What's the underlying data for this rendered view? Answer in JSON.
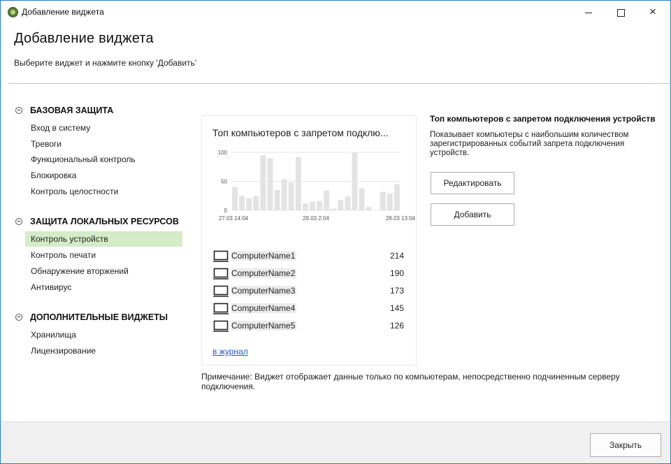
{
  "window": {
    "title": "Добавление виджета",
    "controls": {
      "minimize": "minimize-icon",
      "maximize": "maximize-icon",
      "close": "×"
    }
  },
  "header": {
    "title": "Добавление виджета",
    "subtitle": "Выберите виджет и нажмите кнопку 'Добавить'"
  },
  "sidebar": {
    "groups": [
      {
        "label": "БАЗОВАЯ ЗАЩИТА",
        "items": [
          "Вход в систему",
          "Тревоги",
          "Функциональный контроль",
          "Блокировка",
          "Контроль целостности"
        ]
      },
      {
        "label": "ЗАЩИТА ЛОКАЛЬНЫХ РЕСУРСОВ",
        "items": [
          "Контроль устройств",
          "Контроль печати",
          "Обнаружение вторжений",
          "Антивирус"
        ]
      },
      {
        "label": "ДОПОЛНИТЕЛЬНЫЕ ВИДЖЕТЫ",
        "items": [
          "Хранилища",
          "Лицензирование"
        ]
      }
    ],
    "selected": "Контроль устройств"
  },
  "widget": {
    "title": "Топ компьютеров с запретом подклю...",
    "list": [
      {
        "name": "ComputerName1",
        "count": "214"
      },
      {
        "name": "ComputerName2",
        "count": "190"
      },
      {
        "name": "ComputerName3",
        "count": "173"
      },
      {
        "name": "ComputerName4",
        "count": "145"
      },
      {
        "name": "ComputerName5",
        "count": "126"
      }
    ],
    "link": "в журнал"
  },
  "chart_data": {
    "type": "bar",
    "x_tick_labels": [
      "27.03 14:04",
      "28.03 2:04",
      "28.03 13:04"
    ],
    "y_ticks": [
      "0",
      "50",
      "100"
    ],
    "ylim": [
      0,
      100
    ],
    "values": [
      40,
      25,
      21,
      25,
      95,
      90,
      35,
      54,
      48,
      92,
      12,
      15,
      16,
      34,
      3,
      18,
      24,
      100,
      38,
      6,
      0,
      32,
      29,
      45
    ],
    "bar_color": "#e3e3e3",
    "grid": true
  },
  "info": {
    "title": "Топ компьютеров с запретом подключения устройств",
    "description": "Показывает компьютеры с наибольшим количеством зарегистрированных событий запрета подключения устройств.",
    "edit_label": "Редактировать",
    "add_label": "Добавить"
  },
  "note": "Примечание: Виджет отображает данные только по компьютерам, непосредственно подчиненным серверу подключения.",
  "footer": {
    "close_label": "Закрыть"
  },
  "colors": {
    "selected_bg": "#d4ecc7",
    "link": "#1a5ccf",
    "window_border": "#2b7bd1"
  }
}
